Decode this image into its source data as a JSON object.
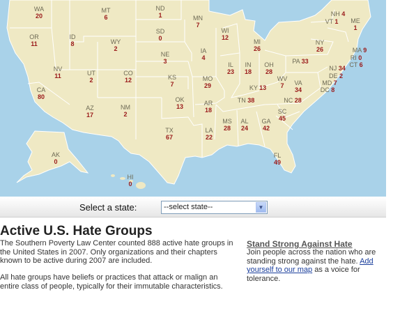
{
  "map": {
    "states": [
      {
        "abbr": "WA",
        "count": "20"
      },
      {
        "abbr": "MT",
        "count": "6"
      },
      {
        "abbr": "ND",
        "count": "1"
      },
      {
        "abbr": "MN",
        "count": "7"
      },
      {
        "abbr": "NH",
        "count": "4"
      },
      {
        "abbr": "VT",
        "count": "1"
      },
      {
        "abbr": "ME",
        "count": "1"
      },
      {
        "abbr": "OR",
        "count": "11"
      },
      {
        "abbr": "ID",
        "count": "8"
      },
      {
        "abbr": "WY",
        "count": "2"
      },
      {
        "abbr": "SD",
        "count": "0"
      },
      {
        "abbr": "WI",
        "count": "12"
      },
      {
        "abbr": "MI",
        "count": "26"
      },
      {
        "abbr": "NY",
        "count": "26"
      },
      {
        "abbr": "MA",
        "count": "9"
      },
      {
        "abbr": "RI",
        "count": "0"
      },
      {
        "abbr": "CT",
        "count": "6"
      },
      {
        "abbr": "NE",
        "count": "3"
      },
      {
        "abbr": "IA",
        "count": "4"
      },
      {
        "abbr": "NV",
        "count": "11"
      },
      {
        "abbr": "UT",
        "count": "2"
      },
      {
        "abbr": "CO",
        "count": "12"
      },
      {
        "abbr": "IL",
        "count": "23"
      },
      {
        "abbr": "IN",
        "count": "18"
      },
      {
        "abbr": "OH",
        "count": "28"
      },
      {
        "abbr": "PA",
        "count": "33"
      },
      {
        "abbr": "NJ",
        "count": "34"
      },
      {
        "abbr": "DE",
        "count": "2"
      },
      {
        "abbr": "MD",
        "count": "7"
      },
      {
        "abbr": "DC",
        "count": "8"
      },
      {
        "abbr": "CA",
        "count": "80"
      },
      {
        "abbr": "KS",
        "count": "7"
      },
      {
        "abbr": "MO",
        "count": "29"
      },
      {
        "abbr": "KY",
        "count": "13"
      },
      {
        "abbr": "WV",
        "count": "7"
      },
      {
        "abbr": "VA",
        "count": "34"
      },
      {
        "abbr": "AZ",
        "count": "17"
      },
      {
        "abbr": "NM",
        "count": "2"
      },
      {
        "abbr": "OK",
        "count": "13"
      },
      {
        "abbr": "AR",
        "count": "18"
      },
      {
        "abbr": "TN",
        "count": "38"
      },
      {
        "abbr": "NC",
        "count": "28"
      },
      {
        "abbr": "SC",
        "count": "45"
      },
      {
        "abbr": "MS",
        "count": "28"
      },
      {
        "abbr": "AL",
        "count": "24"
      },
      {
        "abbr": "GA",
        "count": "42"
      },
      {
        "abbr": "TX",
        "count": "67"
      },
      {
        "abbr": "LA",
        "count": "22"
      },
      {
        "abbr": "FL",
        "count": "49"
      },
      {
        "abbr": "AK",
        "count": "0"
      },
      {
        "abbr": "HI",
        "count": "0"
      }
    ]
  },
  "selector": {
    "label": "Select a state:",
    "selected": "--select state--",
    "arrow": "▼"
  },
  "article": {
    "title": "Active U.S. Hate Groups",
    "paragraph1": "The Southern Poverty Law Center counted 888 active hate groups in the United States in 2007. Only organizations and their chapters known to be active during 2007 are included.",
    "paragraph2": "All hate groups have beliefs or practices that attack or malign an entire class of people, typically for their immutable characteristics."
  },
  "sidebar": {
    "title": "Stand Strong Against Hate",
    "text_before": "Join people across the nation who are standing strong against the hate. ",
    "link": "Add yourself to our map",
    "text_after": " as a voice for tolerance."
  },
  "colors": {
    "ocean": "#a9d2e9",
    "land": "#efe9c4",
    "border": "#ffffff",
    "count": "#9a1a1a"
  }
}
